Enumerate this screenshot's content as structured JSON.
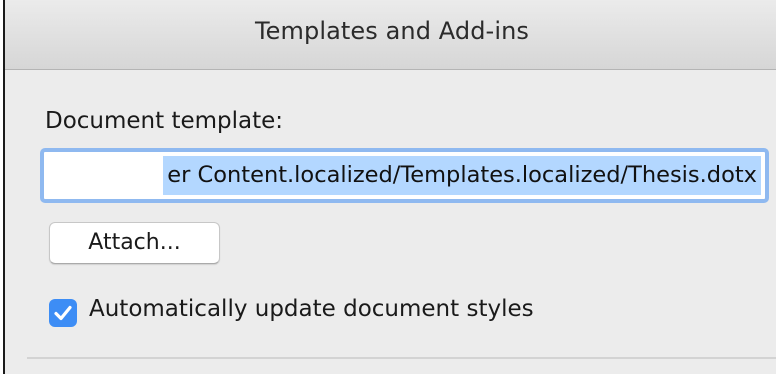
{
  "window": {
    "title": "Templates and Add-ins"
  },
  "document_template": {
    "label": "Document template:",
    "path_visible": "er Content.localized/Templates.localized/Thesis.dotx"
  },
  "attach_button": {
    "label": "Attach..."
  },
  "auto_update": {
    "label": "Automatically update document styles",
    "checked": true
  },
  "colors": {
    "accent": "#3d8df5",
    "focus_ring": "#8fb9f0",
    "selection": "#b3d7ff"
  }
}
